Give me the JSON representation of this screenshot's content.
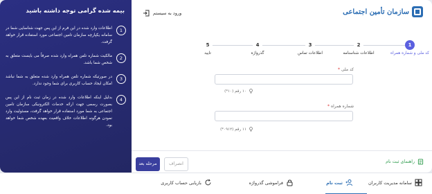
{
  "header": {
    "logo_text": "سازمان تأمین اجتماعی",
    "login_link": "ورود به سیستم"
  },
  "side_panel": {
    "title": "بیمه شده گرامی توجه داشته باشید",
    "notes": [
      {
        "num": "1",
        "text": "اطلاعات وارد شده در این فرم از این پس جهت شناسایی شما در سامانه یکپارچه سازمان تامین اجتماعی مورد استفاده قرار خواهد گرفت."
      },
      {
        "num": "2",
        "text": "مالکیت شماره تلفن همراه وارد شده صرفاً می بایست متعلق به شخص شما باشد."
      },
      {
        "num": "3",
        "text": "در صورتیکه شماره تلفن همراه وارد شده متعلق به شما نباشد امکان ایجاد حساب کاربری برای شما وجود ندارد."
      },
      {
        "num": "4",
        "text": "بدلیل اینکه اطلاعات وارد شده در زمان ثبت نام از این پس بصورت رسمی جهت ارائه خدمات الکترونیکی سازمان تامین اجتماعی به شما مورد استفاده قرار خواهد گرفت، مسئولیت وارد نمودن هرگونه اطلاعات خلاف واقعیت بعهده شخص شما خواهد بود."
      }
    ]
  },
  "stepper": {
    "steps": [
      {
        "num": "1",
        "label": "کد ملی و شماره همراه",
        "active": true
      },
      {
        "num": "2",
        "label": "اطلاعات شناسنامه",
        "active": false
      },
      {
        "num": "3",
        "label": "اطلاعات تماس",
        "active": false
      },
      {
        "num": "4",
        "label": "گذرواژه",
        "active": false
      },
      {
        "num": "5",
        "label": "تایید",
        "active": false
      }
    ]
  },
  "form": {
    "national_code": {
      "label": "کد ملی",
      "required_mark": "*",
      "value": "",
      "hint": "۱۰ رقم (۱۰*)"
    },
    "mobile": {
      "label": "شماره همراه",
      "required_mark": "*",
      "value": "",
      "hint": "۱۱ رقم (۰۹۱۲*)"
    }
  },
  "footer": {
    "guide_label": "راهنمای ثبت نام",
    "next_button": "مرحله بعد",
    "cancel_button": "انصراف"
  },
  "bottom_nav": {
    "items": [
      {
        "label": "سامانه مدیریت کاربران",
        "icon": "grid-icon",
        "active": false
      },
      {
        "label": "ثبت نام",
        "icon": "add-user-icon",
        "active": true
      },
      {
        "label": "فراموشی گذرواژه",
        "icon": "lock-icon",
        "active": false
      },
      {
        "label": "بازیابی حساب کاربری",
        "icon": "refresh-icon",
        "active": false
      }
    ]
  },
  "colors": {
    "panel": "#2b2f83",
    "accent": "#5b60e0",
    "button": "#3a3f9e",
    "link": "#2b6db3",
    "guide": "#2b9a4a"
  }
}
